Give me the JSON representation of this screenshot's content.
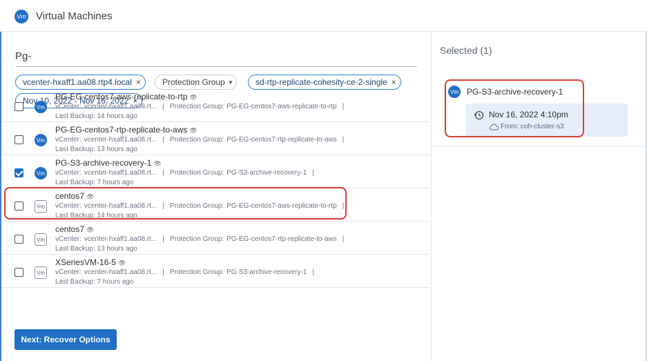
{
  "header": {
    "title": "Virtual Machines",
    "badge": "Vm"
  },
  "search": {
    "query": "Pg-"
  },
  "filters": {
    "chips": [
      {
        "label": "vcenter-hxaff1.aa08.rtp4.local",
        "close": "×"
      },
      {
        "label": "Protection Group",
        "caret": "▾"
      },
      {
        "label": "sd-rtp-replicate-cohesity-ce-2-single",
        "close": "×"
      },
      {
        "label": "Nov 10, 2022 - Nov 16, 2022",
        "close": "×"
      }
    ]
  },
  "meta_labels": {
    "vcenter": "vCenter:",
    "pg": "Protection Group:",
    "sep": "|",
    "eye": "👁"
  },
  "rows": [
    {
      "name": "PG-EG-centos7-aws-replicate-to-rtp",
      "icon": "Vm",
      "icon_style": "badge",
      "vcenter": "vcenter-hxaff1.aa08.rt...",
      "pg": "PG-EG-centos7-aws-replicate-to-rtp",
      "backup": "Last Backup: 14 hours ago",
      "checked": false
    },
    {
      "name": "PG-EG-centos7-rtp-replicate-to-aws",
      "icon": "Vm",
      "icon_style": "badge",
      "vcenter": "vcenter-hxaff1.aa08.rt...",
      "pg": "PG-EG-centos7-rtp-replicate-to-aws",
      "backup": "Last Backup: 13 hours ago",
      "checked": false
    },
    {
      "name": "PG-S3-archive-recovery-1",
      "icon": "Vm",
      "icon_style": "badge",
      "vcenter": "vcenter-hxaff1.aa08.rt...",
      "pg": "PG-S3-archive-recovery-1",
      "backup": "Last Backup: 7 hours ago",
      "checked": true
    },
    {
      "name": "centos7",
      "icon": "Vm",
      "icon_style": "box",
      "vcenter": "vcenter-hxaff1.aa08.rt...",
      "pg": "PG-EG-centos7-aws-replicate-to-rtp",
      "backup": "Last Backup: 14 hours ago",
      "checked": false
    },
    {
      "name": "centos7",
      "icon": "Vm",
      "icon_style": "box",
      "vcenter": "vcenter-hxaff1.aa08.rt...",
      "pg": "PG-EG-centos7-rtp-replicate-to-aws",
      "backup": "Last Backup: 13 hours ago",
      "checked": false
    },
    {
      "name": "XSeriesVM-16-5",
      "icon": "Vm",
      "icon_style": "box",
      "vcenter": "vcenter-hxaff1.aa08.rt...",
      "pg": "PG-S3-archive-recovery-1",
      "backup": "Last Backup: 7 hours ago",
      "checked": false
    }
  ],
  "actions": {
    "next_label": "Next: Recover Options"
  },
  "selected_panel": {
    "title": "Selected (1)",
    "item": {
      "badge": "Vm",
      "name": "PG-S3-archive-recovery-1",
      "snapshot_date": "Nov 16, 2022 4:10pm",
      "from": "From: coh-cluster-s3"
    }
  },
  "colors": {
    "accent": "#1f6fc4",
    "highlight": "#d93a33",
    "snapshot_bg": "#e6eef9"
  }
}
